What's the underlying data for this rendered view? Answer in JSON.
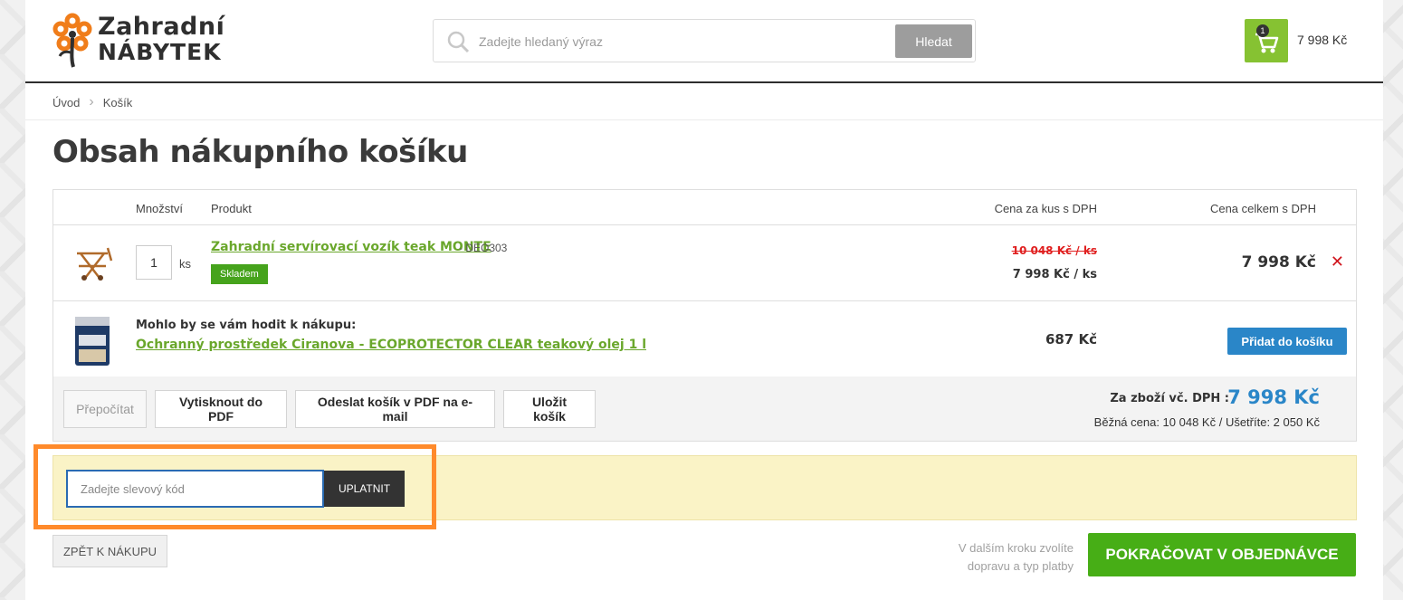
{
  "header": {
    "logo": {
      "line1": "Zahradní",
      "line2": "NÁBYTEK"
    },
    "search": {
      "placeholder": "Zadejte hledaný výraz",
      "button_label": "Hledat"
    },
    "cart": {
      "count": "1",
      "total": "7 998 Kč"
    }
  },
  "breadcrumb": {
    "home": "Úvod",
    "current": "Košík"
  },
  "page_title": "Obsah nákupního košíku",
  "table": {
    "columns": {
      "quantity": "Množství",
      "product": "Produkt",
      "unit_price": "Cena za kus s DPH",
      "total_price": "Cena celkem s DPH"
    },
    "item": {
      "quantity": "1",
      "unit": "ks",
      "name": "Zahradní servírovací vozík teak MONTE",
      "code": "- DEO303",
      "stock": "Skladem",
      "old_price": "10 048 Kč / ks",
      "unit_price": "7 998 Kč / ks",
      "total": "7 998 Kč",
      "remove_symbol": "✕"
    },
    "upsell": {
      "label": "Mohlo by se vám hodit k nákupu:",
      "name": "Ochranný prostředek Ciranova - ECOPROTECTOR CLEAR teakový olej 1 l",
      "price": "687 Kč",
      "button_label": "Přidat do košíku"
    },
    "actions": {
      "recalculate": "Přepočítat",
      "print_pdf": "Vytisknout do PDF",
      "email_pdf": "Odeslat košík v PDF na e-mail",
      "save_cart": "Uložit košík"
    },
    "summary": {
      "label": "Za zboží vč. DPH :",
      "value": "7 998 Kč",
      "sub": "Běžná cena: 10 048 Kč / Ušetříte: 2 050 Kč"
    }
  },
  "discount": {
    "placeholder": "Zadejte slevový kód",
    "button_label": "UPLATNIT"
  },
  "navigation": {
    "back_label": "ZPĚT K NÁKUPU",
    "next_note_line1": "V dalším kroku zvolíte",
    "next_note_line2": "dopravu a typ platby",
    "next_label": "POKRAČOVAT V OBJEDNÁVCE"
  },
  "colors": {
    "accent_green": "#86c232",
    "link_green": "#6aa72c",
    "primary_blue": "#2a86c8",
    "highlight_orange": "#ff8a2b",
    "discount_bg": "#faf3c6",
    "remove_red": "#d0141c"
  }
}
